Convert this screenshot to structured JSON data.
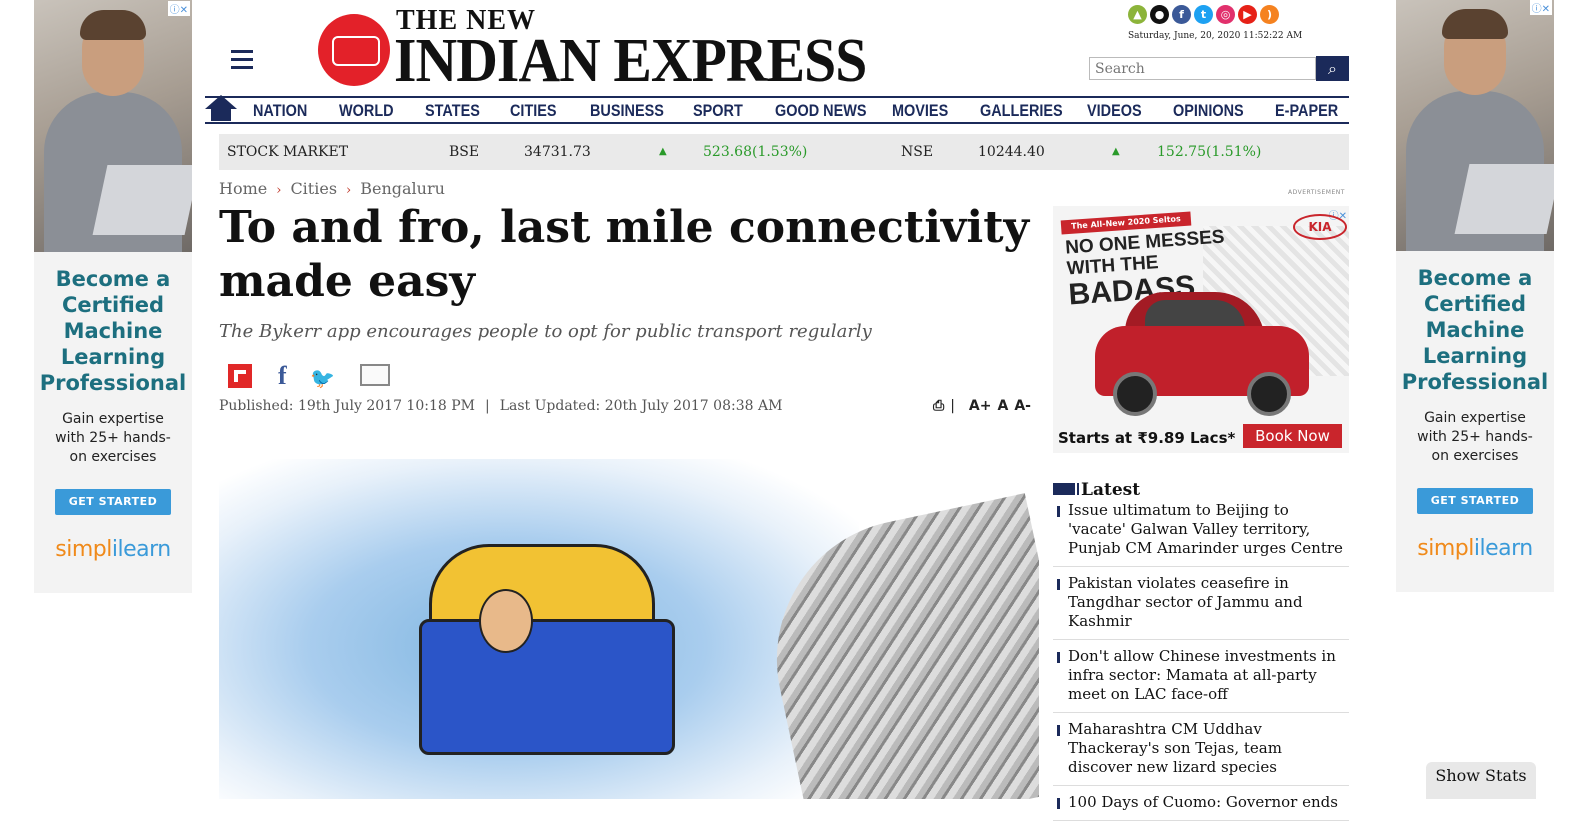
{
  "side_ad": {
    "title": "Become a Certified Machine Learning Professional",
    "desc": "Gain expertise with 25+ hands-on exercises",
    "cta": "GET STARTED",
    "brand_a": "simpl",
    "brand_b": "ilearn",
    "close": "ⓘ✕"
  },
  "header": {
    "logo_top": "THE NEW",
    "logo_main": "INDIAN EXPRESS",
    "datetime": "Saturday, June, 20, 2020  11:52:22 AM",
    "search_placeholder": "Search"
  },
  "nav": [
    "NATION",
    "WORLD",
    "STATES",
    "CITIES",
    "BUSINESS",
    "SPORT",
    "GOOD NEWS",
    "MOVIES",
    "GALLERIES",
    "VIDEOS",
    "OPINIONS",
    "E-PAPER"
  ],
  "stock": {
    "label": "STOCK MARKET",
    "bse": {
      "name": "BSE",
      "value": "34731.73",
      "change": "523.68(1.53%)"
    },
    "nse": {
      "name": "NSE",
      "value": "10244.40",
      "change": "152.75(1.51%)"
    }
  },
  "breadcrumb": [
    "Home",
    "Cities",
    "Bengaluru"
  ],
  "article": {
    "headline": "To and fro, last mile connectivity made easy",
    "subhead": "The Bykerr app encourages people to opt for public transport regularly",
    "published": "Published: 19th July 2017 10:18 PM",
    "updated": "Last Updated: 20th July 2017 08:38 AM",
    "font_up": "A+",
    "font_normal": "A",
    "font_down": "A-"
  },
  "sidebar": {
    "advertisement_label": "ADVERTISEMENT",
    "kia": {
      "strap": "The All-New 2020 Seltos",
      "line1": "NO ONE MESSES",
      "line2": "WITH THE",
      "line3": "BADASS",
      "logo": "KIA",
      "price": "Starts at ₹9.89 Lacs*",
      "button": "Book Now"
    },
    "latest_title": "Latest",
    "latest": [
      "Issue ultimatum to Beijing to 'vacate' Galwan Valley territory, Punjab CM Amarinder urges Centre",
      "Pakistan violates ceasefire in Tangdhar sector of Jammu and Kashmir",
      "Don't allow Chinese investments in infra sector: Mamata at all-party meet on LAC face-off",
      "Maharashtra CM Uddhav Thackeray's son Tejas, team discover new lizard species",
      "100 Days of Cuomo: Governor ends"
    ]
  },
  "show_stats": "Show Stats"
}
